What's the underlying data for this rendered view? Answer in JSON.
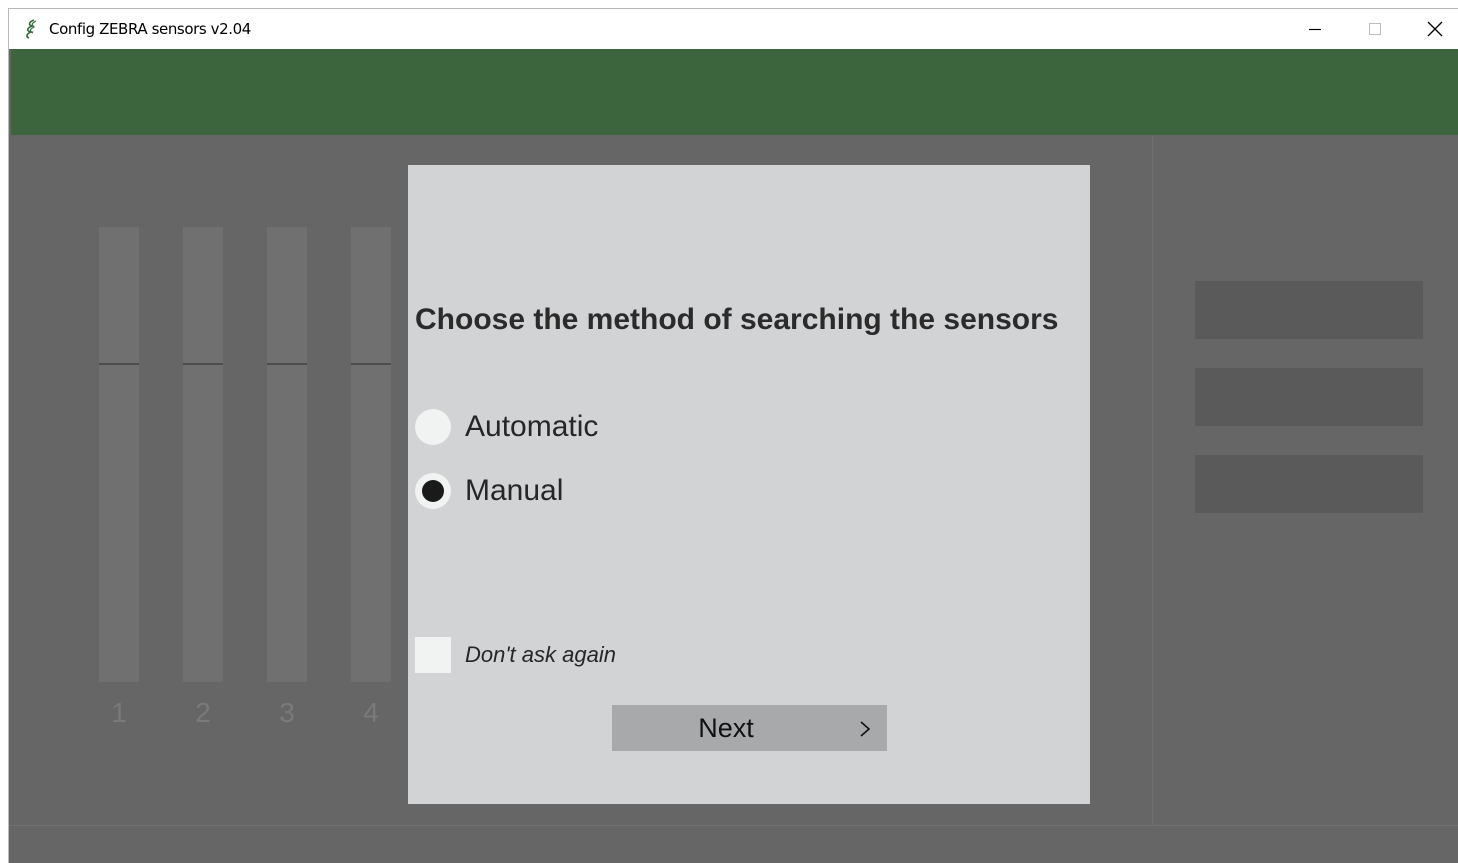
{
  "window": {
    "title": "Config ZEBRA sensors v2.04",
    "icon": "zebra-logo-icon",
    "controls": [
      "minimize-icon",
      "maximize-icon",
      "close-icon"
    ]
  },
  "colors": {
    "header_band": "#3d653d",
    "background": "#666666",
    "dialog": "#d2d3d5",
    "button": "#a8a9ab"
  },
  "sliders": [
    {
      "label": "1"
    },
    {
      "label": "2"
    },
    {
      "label": "3"
    },
    {
      "label": "4"
    }
  ],
  "dialog": {
    "title": "Choose the method of searching the sensors",
    "options": [
      {
        "label": "Automatic",
        "selected": false
      },
      {
        "label": "Manual",
        "selected": true
      }
    ],
    "dont_ask_again": {
      "label": "Don't ask again",
      "checked": false
    },
    "next_button": {
      "label": "Next",
      "icon": "chevron-right-icon"
    }
  }
}
